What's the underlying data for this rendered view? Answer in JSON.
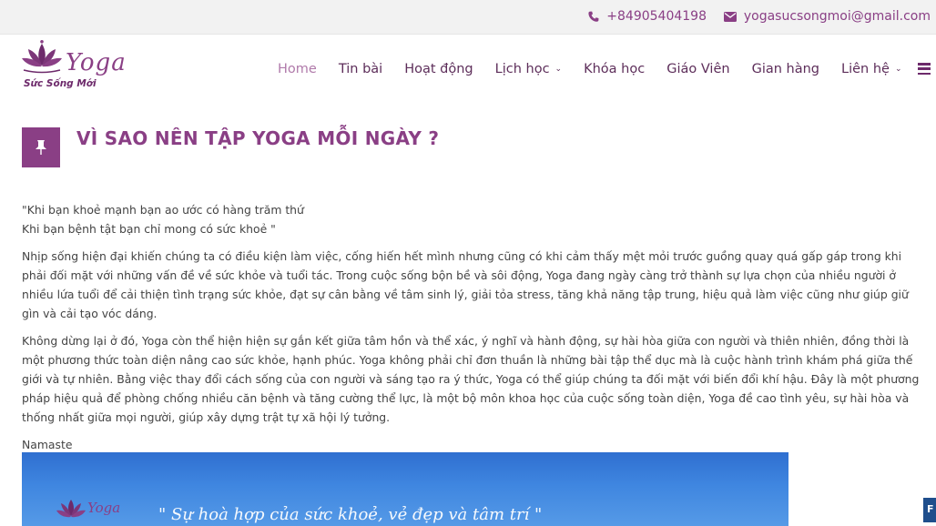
{
  "topbar": {
    "phone": "+84905404198",
    "email": "yogasucsongmoi@gmail.com",
    "phone_icon": "phone-icon",
    "email_icon": "envelope-icon"
  },
  "logo": {
    "word": "Yoga",
    "tagline": "Sức Sống Mới"
  },
  "nav": {
    "items": [
      {
        "label": "Home",
        "active": true
      },
      {
        "label": "Tin bài"
      },
      {
        "label": "Hoạt động"
      },
      {
        "label": "Lịch học",
        "dropdown": true
      },
      {
        "label": "Khóa học"
      },
      {
        "label": "Giáo Viên"
      },
      {
        "label": "Gian hàng"
      },
      {
        "label": "Liên hệ",
        "dropdown": true
      }
    ],
    "menu_icon": "hamburger-icon"
  },
  "article": {
    "icon": "pushpin-icon",
    "title": "VÌ SAO NÊN TẬP YOGA MỖI NGÀY ?",
    "quote_line1": "\"Khi bạn khoẻ mạnh bạn ao ước có hàng trăm thứ",
    "quote_line2": "Khi bạn bệnh tật bạn chỉ mong có sức khoẻ \"",
    "paragraph1": "Nhịp sống hiện đại khiến chúng ta có điều kiện làm việc, cống hiến hết mình nhưng cũng có khi cảm thấy mệt mỏi trước guồng quay quá gấp gáp trong khi phải đối mặt với những vấn đề về sức khỏe và tuổi tác. Trong cuộc sống bộn bề và sôi động, Yoga đang ngày càng trở thành sự lựa chọn của nhiều người ở nhiều lứa tuổi để cải thiện tình trạng sức khỏe, đạt sự cân bằng về tâm sinh lý, giải tỏa stress, tăng khả năng tập trung, hiệu quả làm việc cũng như giúp giữ gìn và cải tạo vóc dáng.",
    "paragraph2": "Không dừng lại ở đó, Yoga còn thể hiện hiện sự gắn kết giữa tâm hồn và thể xác, ý nghĩ và hành động, sự hài hòa giữa con người và thiên nhiên, đồng thời là một phương thức toàn diện nâng cao sức khỏe, hạnh phúc. Yoga không phải chỉ đơn thuần là những bài tập thể dục mà là cuộc hành trình khám phá giữa thế giới và tự nhiên. Bằng việc thay đổi cách sống của con người và sáng tạo ra ý thức, Yoga có thể giúp chúng ta đối mặt với biến đổi khí hậu. Đây là một phương pháp hiệu quả để phòng chống nhiều căn bệnh và tăng cường thể lực, là một bộ môn khoa học của cuộc sống toàn diện, Yoga đề cao tình yêu, sự hài hòa và thống nhất giữa mọi người, giúp xây dựng trật tự xã hội lý tưởng.",
    "signoff": "Namaste"
  },
  "banner": {
    "logo_word": "Yoga",
    "quote": "\" Sự hoà hợp của sức khoẻ, vẻ đẹp và tâm trí \""
  },
  "side_tab": {
    "label": "F"
  },
  "colors": {
    "brand": "#8a3f85",
    "nav_text": "#5d2e5a",
    "nav_active": "#b07aaa",
    "topbar_bg": "#f2f2f2",
    "banner_sky": "#3f86e0"
  }
}
